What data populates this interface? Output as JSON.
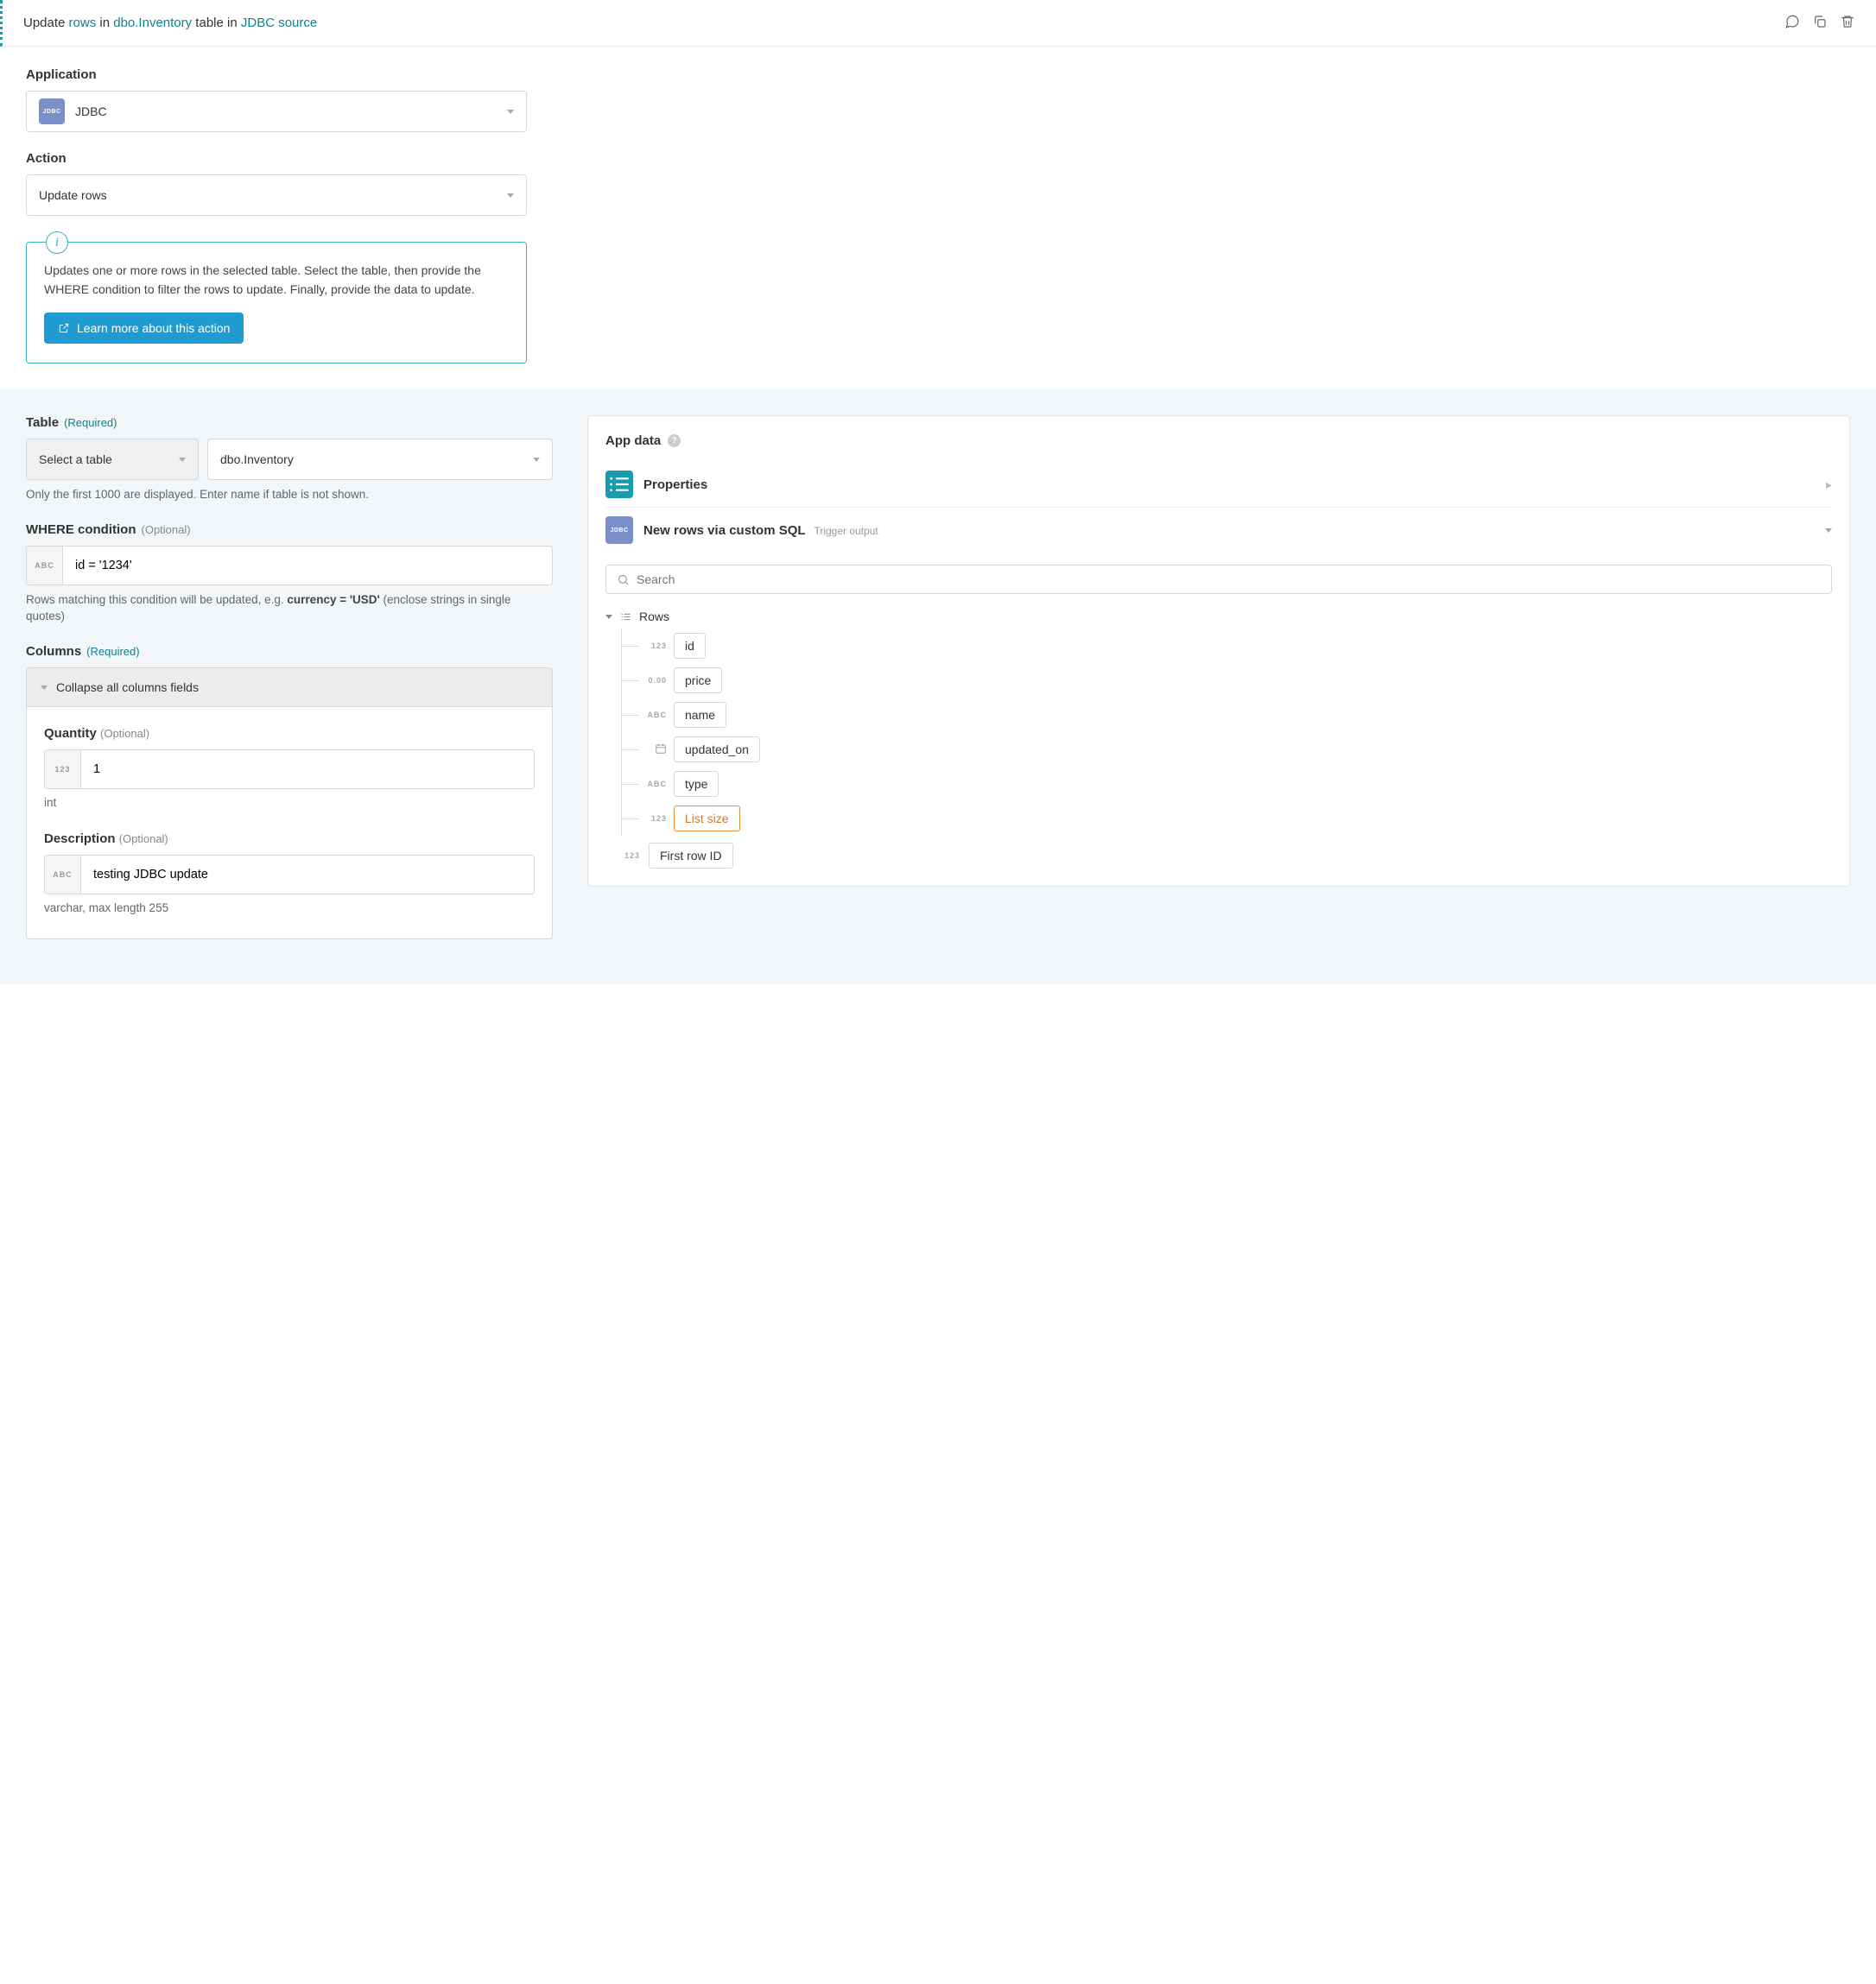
{
  "header": {
    "prefix": "Update ",
    "rows_link": "rows",
    "mid1": " in ",
    "table_link": "dbo.Inventory",
    "mid2": " table in ",
    "source_link": "JDBC source"
  },
  "application": {
    "label": "Application",
    "badge": "JDBC",
    "value": "JDBC"
  },
  "action": {
    "label": "Action",
    "value": "Update rows"
  },
  "info": {
    "text": "Updates one or more rows in the selected table. Select the table, then provide the WHERE condition to filter the rows to update. Finally, provide the data to update.",
    "button": "Learn more about this action"
  },
  "table": {
    "label": "Table",
    "req": "(Required)",
    "select_label": "Select a table",
    "value": "dbo.Inventory",
    "hint": "Only the first 1000 are displayed. Enter name if table is not shown."
  },
  "where": {
    "label": "WHERE condition",
    "opt": "(Optional)",
    "type_tag": "ABC",
    "value": "id = '1234'",
    "hint_pre": "Rows matching this condition will be updated, e.g. ",
    "hint_bold": "currency = 'USD'",
    "hint_post": " (enclose strings in single quotes)"
  },
  "columns": {
    "label": "Columns",
    "req": "(Required)",
    "collapse": "Collapse all columns fields",
    "fields": {
      "quantity": {
        "label": "Quantity",
        "opt": "(Optional)",
        "type_tag": "123",
        "value": "1",
        "hint": "int"
      },
      "description": {
        "label": "Description",
        "opt": "(Optional)",
        "type_tag": "ABC",
        "value": "testing JDBC update",
        "hint": "varchar, max length 255"
      }
    }
  },
  "appdata": {
    "title": "App data",
    "properties": "Properties",
    "trigger_title": "New rows via custom SQL",
    "trigger_sub": "Trigger output",
    "search_placeholder": "Search",
    "rows_label": "Rows",
    "items": [
      {
        "dtype": "123",
        "label": "id"
      },
      {
        "dtype": "0.00",
        "label": "price"
      },
      {
        "dtype": "ABC",
        "label": "name"
      },
      {
        "dtype": "cal",
        "label": "updated_on"
      },
      {
        "dtype": "ABC",
        "label": "type"
      },
      {
        "dtype": "123",
        "label": "List size",
        "hl": true
      }
    ],
    "flat": {
      "dtype": "123",
      "label": "First row ID"
    }
  }
}
